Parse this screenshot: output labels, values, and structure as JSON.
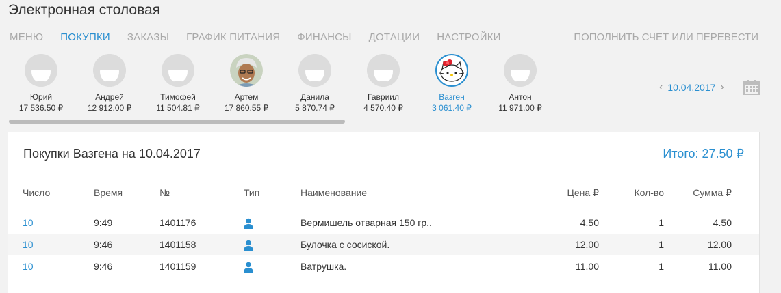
{
  "app": {
    "title": "Электронная столовая"
  },
  "nav": {
    "items": [
      {
        "label": "МЕНЮ"
      },
      {
        "label": "ПОКУПКИ"
      },
      {
        "label": "ЗАКАЗЫ"
      },
      {
        "label": "ГРАФИК ПИТАНИЯ"
      },
      {
        "label": "ФИНАНСЫ"
      },
      {
        "label": "ДОТАЦИИ"
      },
      {
        "label": "НАСТРОЙКИ"
      }
    ],
    "active_index": 1,
    "right_action": "ПОПОЛНИТЬ СЧЕТ ИЛИ ПЕРЕВЕСТИ"
  },
  "people": [
    {
      "name": "Юрий",
      "balance": "17 536.50 ₽",
      "avatar": "default-avatar-icon"
    },
    {
      "name": "Андрей",
      "balance": "12 912.00 ₽",
      "avatar": "default-avatar-icon"
    },
    {
      "name": "Тимофей",
      "balance": "11 504.81 ₽",
      "avatar": "default-avatar-icon"
    },
    {
      "name": "Артем",
      "balance": "17 860.55 ₽",
      "avatar": "photo-avatar"
    },
    {
      "name": "Данила",
      "balance": "5 870.74 ₽",
      "avatar": "default-avatar-icon"
    },
    {
      "name": "Гавриил",
      "balance": "4 570.40 ₽",
      "avatar": "default-avatar-icon"
    },
    {
      "name": "Вазген",
      "balance": "3 061.40 ₽",
      "avatar": "hello-kitty-avatar",
      "active": true
    },
    {
      "name": "Антон",
      "balance": "11 971.00 ₽",
      "avatar": "default-avatar-icon"
    }
  ],
  "date": {
    "prev_icon": "chevron-left-icon",
    "value": "10.04.2017",
    "next_icon": "chevron-right-icon",
    "calendar_icon": "calendar-icon"
  },
  "purchases": {
    "title": "Покупки Вазгена на 10.04.2017",
    "total": "Итого: 27.50 ₽",
    "columns": {
      "day": "Число",
      "time": "Время",
      "number": "№",
      "type": "Тип",
      "name": "Наименование",
      "price": "Цена ₽",
      "qty": "Кол-во",
      "sum": "Сумма ₽"
    },
    "rows": [
      {
        "day": "10",
        "time": "9:49",
        "number": "1401176",
        "type_icon": "person-icon",
        "name": "Вермишель отварная 150 гр..",
        "price": "4.50",
        "qty": "1",
        "sum": "4.50"
      },
      {
        "day": "10",
        "time": "9:46",
        "number": "1401158",
        "type_icon": "person-icon",
        "name": "Булочка с сосиской.",
        "price": "12.00",
        "qty": "1",
        "sum": "12.00"
      },
      {
        "day": "10",
        "time": "9:46",
        "number": "1401159",
        "type_icon": "person-icon",
        "name": "Ватрушка.",
        "price": "11.00",
        "qty": "1",
        "sum": "11.00"
      }
    ]
  },
  "colors": {
    "accent": "#2a8fd0",
    "muted": "#a9a9a9",
    "background": "#f2f2f2"
  }
}
